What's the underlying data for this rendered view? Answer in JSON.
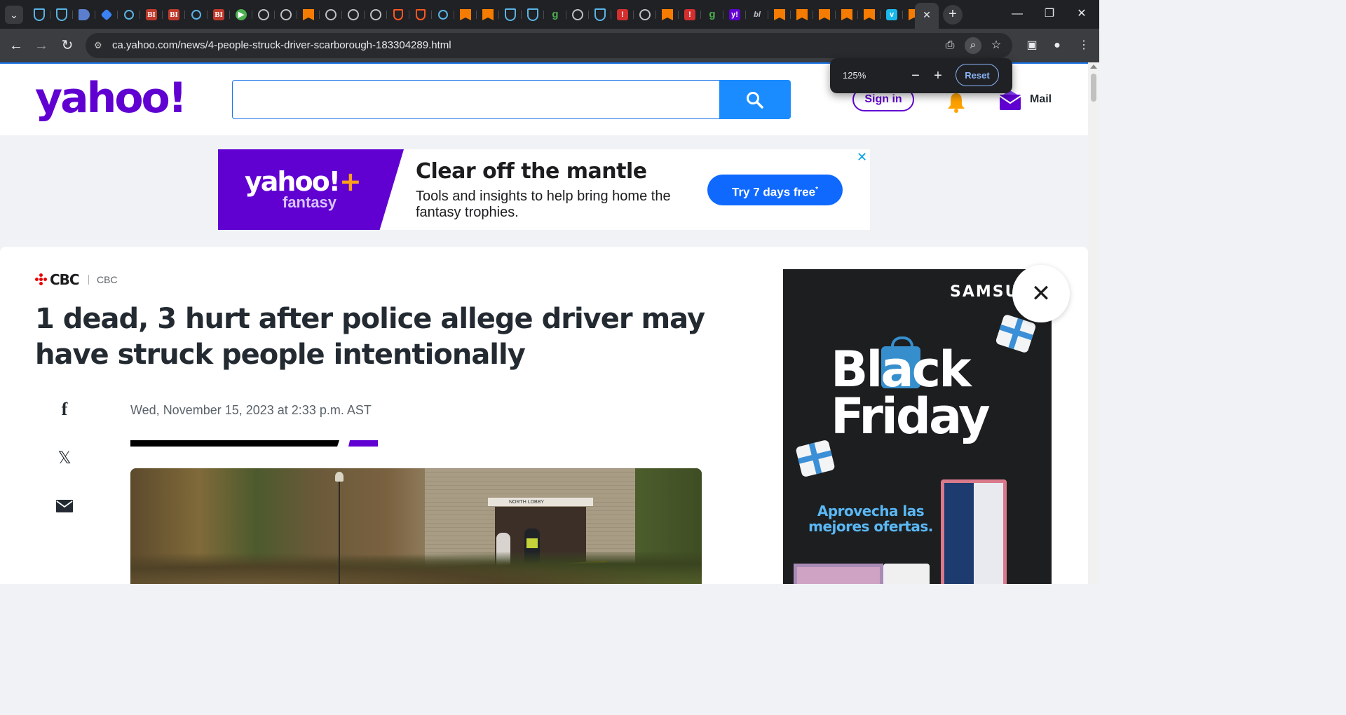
{
  "browser": {
    "tab_favicons": [
      {
        "name": "shield",
        "cls": "f-shield",
        "glyph": ""
      },
      {
        "name": "shield",
        "cls": "f-shield",
        "glyph": ""
      },
      {
        "name": "d-logo",
        "cls": "f-d",
        "glyph": ""
      },
      {
        "name": "graduation",
        "cls": "f-cap",
        "glyph": ""
      },
      {
        "name": "search",
        "cls": "f-search",
        "glyph": ""
      },
      {
        "name": "business-insider",
        "cls": "f-bi",
        "glyph": "BI"
      },
      {
        "name": "business-insider",
        "cls": "f-bi",
        "glyph": "BI"
      },
      {
        "name": "search",
        "cls": "f-search",
        "glyph": ""
      },
      {
        "name": "business-insider",
        "cls": "f-bi",
        "glyph": "BI"
      },
      {
        "name": "play",
        "cls": "f-play",
        "glyph": "▶"
      },
      {
        "name": "globe",
        "cls": "f-globe",
        "glyph": ""
      },
      {
        "name": "globe",
        "cls": "f-globe",
        "glyph": ""
      },
      {
        "name": "bookmark",
        "cls": "f-bm",
        "glyph": ""
      },
      {
        "name": "globe",
        "cls": "f-globe",
        "glyph": ""
      },
      {
        "name": "globe",
        "cls": "f-globe",
        "glyph": ""
      },
      {
        "name": "globe",
        "cls": "f-globe",
        "glyph": ""
      },
      {
        "name": "u-shield",
        "cls": "f-u",
        "glyph": ""
      },
      {
        "name": "u-shield",
        "cls": "f-u",
        "glyph": ""
      },
      {
        "name": "search",
        "cls": "f-search",
        "glyph": ""
      },
      {
        "name": "bookmark",
        "cls": "f-bm",
        "glyph": ""
      },
      {
        "name": "bookmark",
        "cls": "f-bm",
        "glyph": ""
      },
      {
        "name": "shield",
        "cls": "f-shield",
        "glyph": ""
      },
      {
        "name": "shield",
        "cls": "f-shield",
        "glyph": ""
      },
      {
        "name": "g-logo",
        "cls": "f-g",
        "glyph": "g"
      },
      {
        "name": "globe",
        "cls": "f-globe",
        "glyph": ""
      },
      {
        "name": "shield",
        "cls": "f-shield",
        "glyph": ""
      },
      {
        "name": "red-badge",
        "cls": "f-red",
        "glyph": "!"
      },
      {
        "name": "globe",
        "cls": "f-globe",
        "glyph": ""
      },
      {
        "name": "bookmark",
        "cls": "f-bm",
        "glyph": ""
      },
      {
        "name": "red-badge",
        "cls": "f-red",
        "glyph": "!"
      },
      {
        "name": "g-logo",
        "cls": "f-g",
        "glyph": "g"
      },
      {
        "name": "yahoo",
        "cls": "f-y",
        "glyph": "y!"
      },
      {
        "name": "nb-logo",
        "cls": "f-nb",
        "glyph": "bl"
      },
      {
        "name": "bookmark",
        "cls": "f-bm",
        "glyph": ""
      },
      {
        "name": "bookmark",
        "cls": "f-bm",
        "glyph": ""
      },
      {
        "name": "bookmark",
        "cls": "f-bm",
        "glyph": ""
      },
      {
        "name": "bookmark",
        "cls": "f-bm",
        "glyph": ""
      },
      {
        "name": "bookmark",
        "cls": "f-bm",
        "glyph": ""
      },
      {
        "name": "vimeo",
        "cls": "f-v",
        "glyph": "v"
      },
      {
        "name": "bookmark",
        "cls": "f-bm",
        "glyph": ""
      }
    ],
    "active_tab_close": "✕",
    "new_tab": "+",
    "url_host": "ca.yahoo.com",
    "url_path": "/news/4-people-struck-driver-scarborough-183304289.html",
    "zoom": {
      "level": "125%",
      "minus": "−",
      "plus": "+",
      "reset": "Reset"
    }
  },
  "header": {
    "logo": "yahoo!",
    "search_placeholder": "",
    "sign_in": "Sign in",
    "mail": "Mail"
  },
  "top_ad": {
    "brand": "yahoo!",
    "brand_plus": "+",
    "brand_sub": "fantasy",
    "headline": "Clear off the mantle",
    "subtext": "Tools and insights to help bring home the fantasy trophies.",
    "cta": "Try 7 days free",
    "cta_sup": "*",
    "close": "✕"
  },
  "article": {
    "source_logo": "CBC",
    "source_name": "CBC",
    "headline": "1 dead, 3 hurt after police allege driver may have struck people intentionally",
    "date": "Wed, November 15, 2023 at 2:33 p.m. AST",
    "photo_sign": "NORTH LOBBY"
  },
  "side_ad": {
    "brand": "SAMSU",
    "line1": "Black",
    "line2": "Friday",
    "promo": "Aprovecha las mejores ofertas.",
    "close": "✕"
  },
  "colors": {
    "yahoo_purple": "#6001d2",
    "search_blue": "#1a8cff",
    "cta_blue": "#0f69ff",
    "cbc_red": "#e60505"
  }
}
